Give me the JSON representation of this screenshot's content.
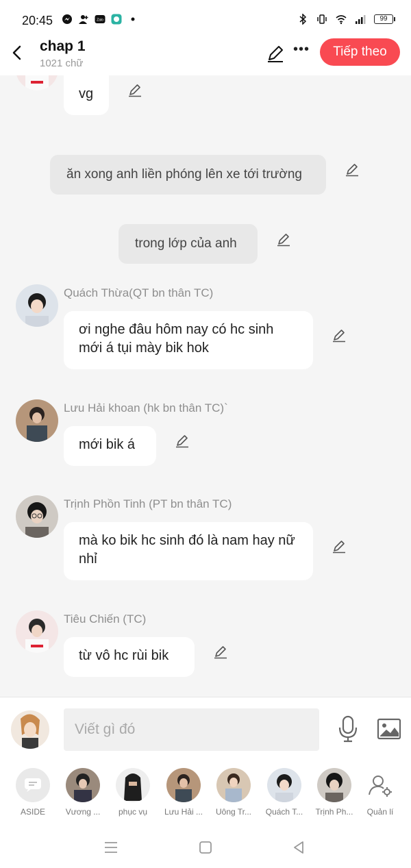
{
  "status": {
    "time": "20:45",
    "battery": "99"
  },
  "header": {
    "title": "chap 1",
    "subtitle": "1021 chữ",
    "next_label": "Tiếp theo"
  },
  "messages": [
    {
      "type": "character",
      "sender": "",
      "text": "vg"
    },
    {
      "type": "narration",
      "text": "ăn xong anh liền phóng lên xe tới trường"
    },
    {
      "type": "narration",
      "text": "trong lớp của anh"
    },
    {
      "type": "character",
      "sender": "Quách Thừa(QT bn thân TC)",
      "text": "ơi nghe đâu hôm nay có hc sinh mới á tụi mày bik hok"
    },
    {
      "type": "character",
      "sender": "Lưu Hải khoan (hk bn thân TC)`",
      "text": "mới bik á"
    },
    {
      "type": "character",
      "sender": "Trịnh Phồn Tinh (PT bn thân TC)",
      "text": "mà ko bik hc sinh đó là nam hay nữ nhỉ"
    },
    {
      "type": "character",
      "sender": "Tiêu Chiến (TC)",
      "text": "từ vô hc rùi bik"
    }
  ],
  "input": {
    "placeholder": "Viết gì đó"
  },
  "characters": [
    {
      "label": "ASIDE"
    },
    {
      "label": "Vương ..."
    },
    {
      "label": "phục vụ"
    },
    {
      "label": "Lưu Hải ..."
    },
    {
      "label": "Uông Tr..."
    },
    {
      "label": "Quách T..."
    },
    {
      "label": "Trịnh Ph..."
    },
    {
      "label": "Quản lí"
    }
  ],
  "colors": {
    "accent": "#f94a52",
    "background": "#f5f5f5",
    "narration_bg": "#e8e8e8"
  }
}
